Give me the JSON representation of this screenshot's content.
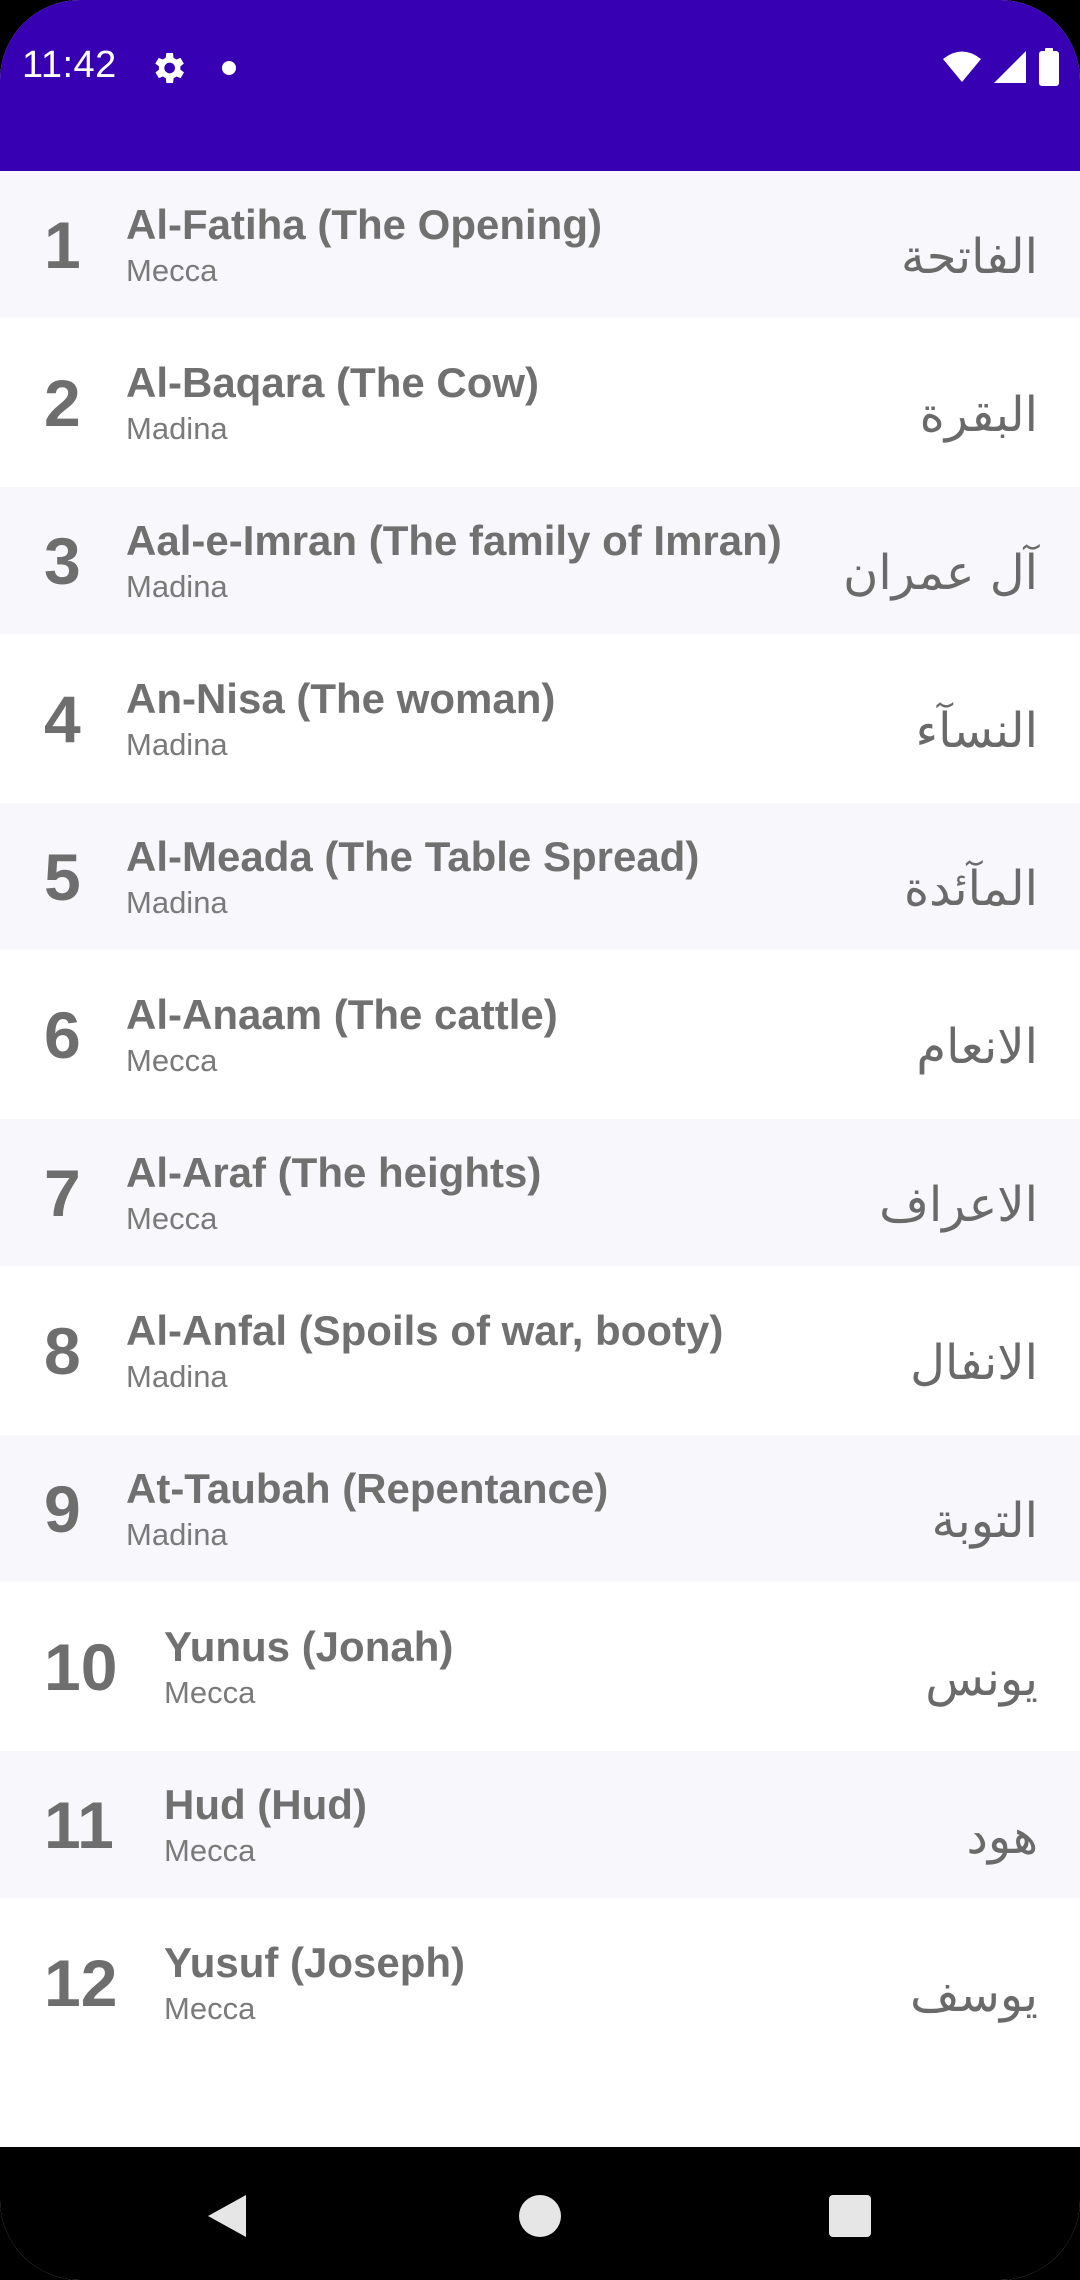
{
  "status_bar": {
    "time": "11:42",
    "icons_left": [
      "gear-icon",
      "notification-dot-icon"
    ],
    "icons_right": [
      "wifi-icon",
      "cellular-signal-icon",
      "battery-icon"
    ]
  },
  "colors": {
    "app_bar": "#3700b3",
    "row_alt": "#f8f7fb",
    "text": "#707070"
  },
  "surahs": [
    {
      "number": "1",
      "name": "Al-Fatiha (The Opening)",
      "place": "Mecca",
      "arabic": "الفاتحة"
    },
    {
      "number": "2",
      "name": "Al-Baqara (The Cow)",
      "place": "Madina",
      "arabic": "البقرة"
    },
    {
      "number": "3",
      "name": "Aal-e-Imran (The family of Imran)",
      "place": "Madina",
      "arabic": "آل عمران"
    },
    {
      "number": "4",
      "name": "An-Nisa (The woman)",
      "place": "Madina",
      "arabic": "النسآء"
    },
    {
      "number": "5",
      "name": "Al-Meada (The Table Spread)",
      "place": "Madina",
      "arabic": "المآئدة"
    },
    {
      "number": "6",
      "name": "Al-Anaam (The cattle)",
      "place": "Mecca",
      "arabic": "الانعام"
    },
    {
      "number": "7",
      "name": "Al-Araf (The heights)",
      "place": "Mecca",
      "arabic": "الاعراف"
    },
    {
      "number": "8",
      "name": "Al-Anfal (Spoils of war, booty)",
      "place": "Madina",
      "arabic": "الانفال"
    },
    {
      "number": "9",
      "name": "At-Taubah (Repentance)",
      "place": "Madina",
      "arabic": "التوبة"
    },
    {
      "number": "10",
      "name": "Yunus (Jonah)",
      "place": "Mecca",
      "arabic": "یونس"
    },
    {
      "number": "11",
      "name": "Hud (Hud)",
      "place": "Mecca",
      "arabic": "ھود"
    },
    {
      "number": "12",
      "name": "Yusuf (Joseph)",
      "place": "Mecca",
      "arabic": "یوسف"
    }
  ],
  "nav_bar": {
    "buttons": [
      "back-icon",
      "home-icon",
      "recents-icon"
    ]
  }
}
